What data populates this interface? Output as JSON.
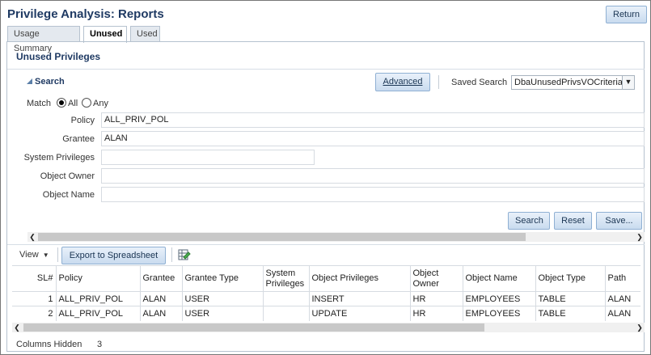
{
  "page": {
    "title": "Privilege Analysis: Reports",
    "return_label": "Return"
  },
  "tabs": [
    {
      "label": "Usage Summary",
      "active": false
    },
    {
      "label": "Unused",
      "active": true
    },
    {
      "label": "Used",
      "active": false
    }
  ],
  "section": {
    "title": "Unused Privileges"
  },
  "search": {
    "title": "Search",
    "advanced_label": "Advanced",
    "saved_search_label": "Saved Search",
    "saved_search_value": "DbaUnusedPrivsVOCriteria",
    "match_label": "Match",
    "match_all": "All",
    "match_any": "Any",
    "match_selected": "All",
    "fields": [
      {
        "label": "Policy",
        "value": "ALL_PRIV_POL"
      },
      {
        "label": "Grantee",
        "value": "ALAN"
      },
      {
        "label": "System Privileges",
        "value": ""
      },
      {
        "label": "Object Owner",
        "value": ""
      },
      {
        "label": "Object Name",
        "value": ""
      }
    ],
    "buttons": {
      "search": "Search",
      "reset": "Reset",
      "save": "Save..."
    }
  },
  "results": {
    "view_label": "View",
    "export_label": "Export to Spreadsheet",
    "columns": [
      "SL#",
      "Policy",
      "Grantee",
      "Grantee Type",
      "System Privileges",
      "Object Privileges",
      "Object Owner",
      "Object Name",
      "Object Type",
      "Path"
    ],
    "rows": [
      [
        "1",
        "ALL_PRIV_POL",
        "ALAN",
        "USER",
        "",
        "INSERT",
        "HR",
        "EMPLOYEES",
        "TABLE",
        "ALAN"
      ],
      [
        "2",
        "ALL_PRIV_POL",
        "ALAN",
        "USER",
        "",
        "UPDATE",
        "HR",
        "EMPLOYEES",
        "TABLE",
        "ALAN"
      ]
    ],
    "columns_hidden_label": "Columns Hidden",
    "columns_hidden_count": "3"
  },
  "colors": {
    "title": "#1f3a63",
    "button_bg": "#c9dbef",
    "border": "#b6c2cf"
  },
  "icons": {
    "search_toggle": "triangle-collapse-icon",
    "export_extra": "spreadsheet-edit-icon",
    "dropdown": "chevron-down-icon"
  }
}
